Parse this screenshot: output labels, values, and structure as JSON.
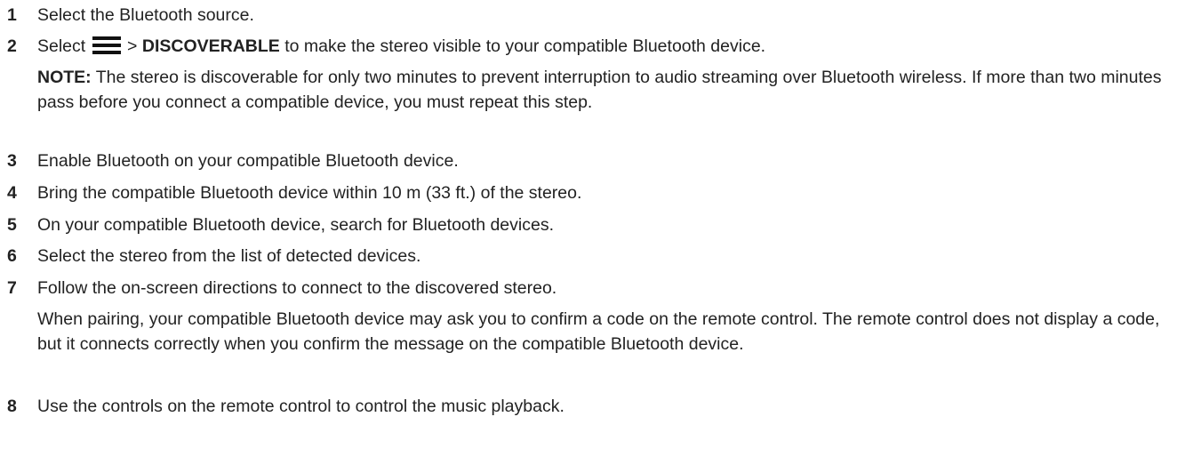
{
  "steps": [
    {
      "num": "1",
      "text": "Select the Bluetooth source."
    },
    {
      "num": "2",
      "pre": "Select",
      "mid": ">",
      "bold": "DISCOVERABLE",
      "post": "to make the stereo visible to your compatible Bluetooth device."
    },
    {
      "num": "3",
      "text": "Enable Bluetooth on your compatible Bluetooth device."
    },
    {
      "num": "4",
      "text": "Bring the compatible Bluetooth device within 10 m (33 ft.) of the stereo."
    },
    {
      "num": "5",
      "text": "On your compatible Bluetooth device, search for Bluetooth devices."
    },
    {
      "num": "6",
      "text": "Select the stereo from the list of detected devices."
    },
    {
      "num": "7",
      "text": "Follow the on-screen directions to connect to the discovered stereo."
    },
    {
      "num": "8",
      "text": "Use the controls on the remote control to control the music playback."
    }
  ],
  "note": {
    "label": "NOTE:",
    "text": "The stereo is discoverable for only two minutes to prevent interruption to audio streaming over Bluetooth wireless. If more than two minutes pass before you connect a compatible device, you must repeat this step."
  },
  "pairing_info": "When pairing, your compatible Bluetooth device may ask you to confirm a code on the remote control. The remote control does not display a code, but it connects correctly when you confirm the message on the compatible Bluetooth device.",
  "icons": {
    "menu": "menu-icon"
  }
}
